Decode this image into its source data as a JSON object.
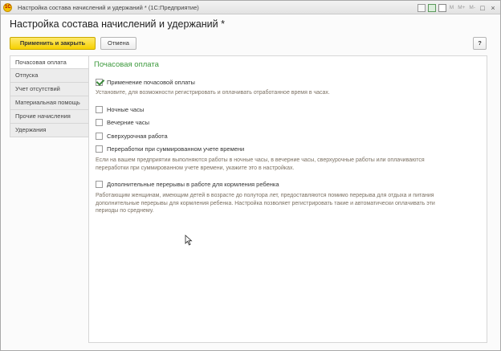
{
  "window": {
    "title": "Настройка состава начислений и удержаний * (1С:Предприятие)",
    "logo_text": "1С",
    "toolbar_memory_labels": [
      "M",
      "M+",
      "M-"
    ],
    "window_controls": [
      "□",
      "×"
    ]
  },
  "header": {
    "title": "Настройка состава начислений и удержаний *"
  },
  "buttons": {
    "apply_close": "Применить и закрыть",
    "cancel": "Отмена",
    "help": "?"
  },
  "sidebar": {
    "items": [
      {
        "label": "Почасовая оплата",
        "active": true
      },
      {
        "label": "Отпуска",
        "active": false
      },
      {
        "label": "Учет отсутствий",
        "active": false
      },
      {
        "label": "Материальная помощь",
        "active": false
      },
      {
        "label": "Прочие начисления",
        "active": false
      },
      {
        "label": "Удержания",
        "active": false
      }
    ]
  },
  "content": {
    "section_title": "Почасовая оплата",
    "hourly": {
      "label": "Применение почасовой оплаты",
      "checked": true,
      "note": "Установите, для возможности регистрировать и оплачивать отработанное время в часах."
    },
    "options": [
      {
        "label": "Ночные часы",
        "checked": false
      },
      {
        "label": "Вечерние часы",
        "checked": false
      },
      {
        "label": "Сверхурочная работа",
        "checked": false
      },
      {
        "label": "Переработки при суммированном учете времени",
        "checked": false
      }
    ],
    "options_note": "Если на вашем предприятии выполняются работы в ночные часы, в вечерние часы, сверхурочные работы или оплачиваются переработки при суммированном учете времени, укажите это в настройках.",
    "breastfeeding": {
      "label": "Дополнительные перерывы в работе для кормления ребенка",
      "checked": false,
      "note": "Работающим женщинам, имеющим детей в возрасте до полутора лет, предоставляются помимо перерыва для отдыха и питания дополнительные перерывы для кормления ребенка. Настройка позволяет регистрировать такие и автоматически оплачивать эти периоды по среднему."
    }
  },
  "colors": {
    "accent_green": "#3d9a3d",
    "primary_button": "#f6d100",
    "note_text": "#7b7062"
  }
}
